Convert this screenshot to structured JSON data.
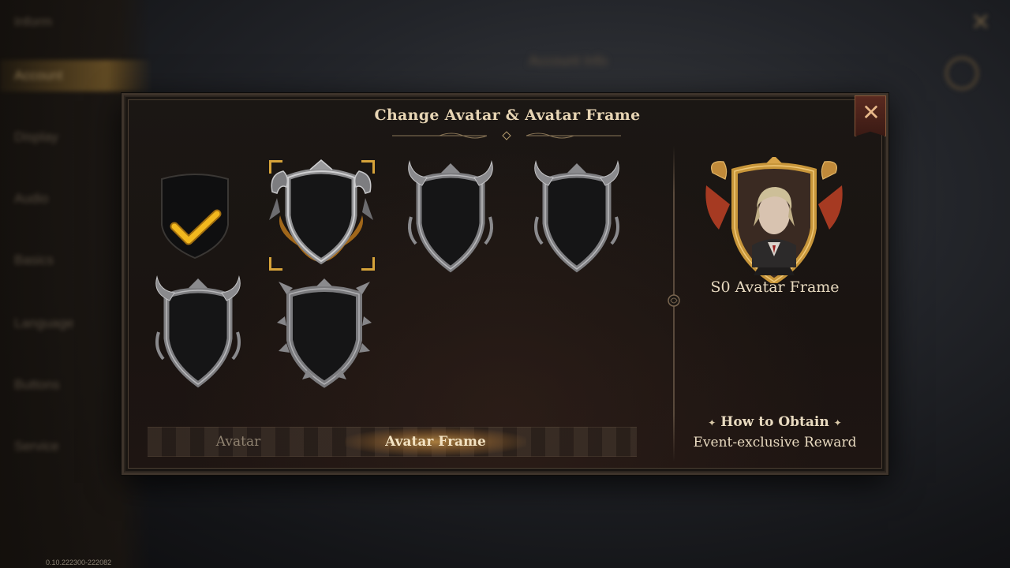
{
  "background": {
    "menu_items": [
      "Inform",
      "Account",
      "Display",
      "Audio",
      "Basics",
      "Language",
      "Buttons",
      "Service"
    ],
    "active_item_index": 1,
    "header_title": "Account Info",
    "version": "0.10.222300-222082"
  },
  "dialog": {
    "title": "Change Avatar & Avatar Frame",
    "close_icon": "close-x-icon",
    "frames": [
      {
        "id": "default",
        "style": "plain-shield",
        "equipped": true,
        "selected": false
      },
      {
        "id": "s0",
        "style": "dragon-shield",
        "equipped": false,
        "selected": true
      },
      {
        "id": "horned-1",
        "style": "horned-shield",
        "equipped": false,
        "selected": false
      },
      {
        "id": "horned-2",
        "style": "horned-shield",
        "equipped": false,
        "selected": false
      },
      {
        "id": "horned-3",
        "style": "horned-shield",
        "equipped": false,
        "selected": false
      },
      {
        "id": "thorn",
        "style": "thorn-shield",
        "equipped": false,
        "selected": false
      }
    ],
    "tabs": [
      {
        "label": "Avatar",
        "active": false
      },
      {
        "label": "Avatar Frame",
        "active": true
      }
    ]
  },
  "detail": {
    "frame_name": "S0 Avatar Frame",
    "how_to_obtain_label": "How to Obtain",
    "how_to_obtain_value": "Event-exclusive Reward"
  },
  "colors": {
    "accent_gold": "#d6a33a",
    "text_light": "#e8dac0",
    "check_gold": "#f2b81e"
  }
}
